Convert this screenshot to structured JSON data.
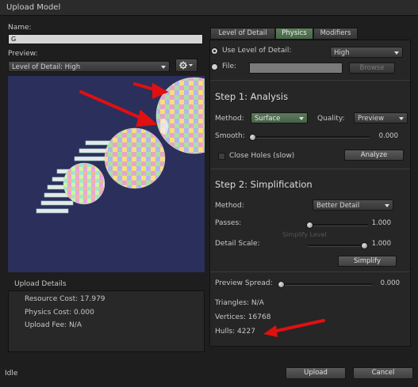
{
  "window": {
    "title": "Upload Model"
  },
  "left": {
    "name_label": "Name:",
    "name_value": "G",
    "preview_label": "Preview:",
    "preview_select": "Level of Detail: High",
    "gear_icon": "gear-icon"
  },
  "upload_details": {
    "title": "Upload Details",
    "resource_cost": "Resource Cost: 17.979",
    "physics_cost": "Physics Cost: 0.000",
    "upload_fee": "Upload Fee: N/A"
  },
  "status": {
    "text": "Idle"
  },
  "buttons": {
    "upload": "Upload",
    "cancel": "Cancel"
  },
  "tabs": [
    {
      "label": "Level of Detail"
    },
    {
      "label": "Physics"
    },
    {
      "label": "Modifiers"
    }
  ],
  "source": {
    "use_lod_label": "Use Level of Detail:",
    "use_lod_value": "High",
    "file_label": "File:",
    "browse": "Browse"
  },
  "step1": {
    "title": "Step 1: Analysis",
    "method_label": "Method:",
    "method_value": "Surface",
    "quality_label": "Quality:",
    "quality_value": "Preview",
    "smooth_label": "Smooth:",
    "smooth_value": "0.000",
    "close_holes_label": "Close Holes (slow)",
    "analyze": "Analyze"
  },
  "step2": {
    "title": "Step 2: Simplification",
    "method_label": "Method:",
    "method_value": "Better Detail",
    "passes_label": "Passes:",
    "passes_value": "1.000",
    "detail_scale_label": "Detail Scale:",
    "detail_scale_value": "1.000",
    "ghost_label": "Simplify Level",
    "simplify": "Simplify"
  },
  "results": {
    "preview_spread_label": "Preview Spread:",
    "preview_spread_value": "0.000",
    "triangles": "Triangles: N/A",
    "vertices": "Vertices: 16768",
    "hulls": "Hulls: 4227"
  },
  "colors": {
    "active_tab": "#5d7f5d",
    "annotation_arrow": "#e01010",
    "preview_bg": "#2b2f5c"
  }
}
